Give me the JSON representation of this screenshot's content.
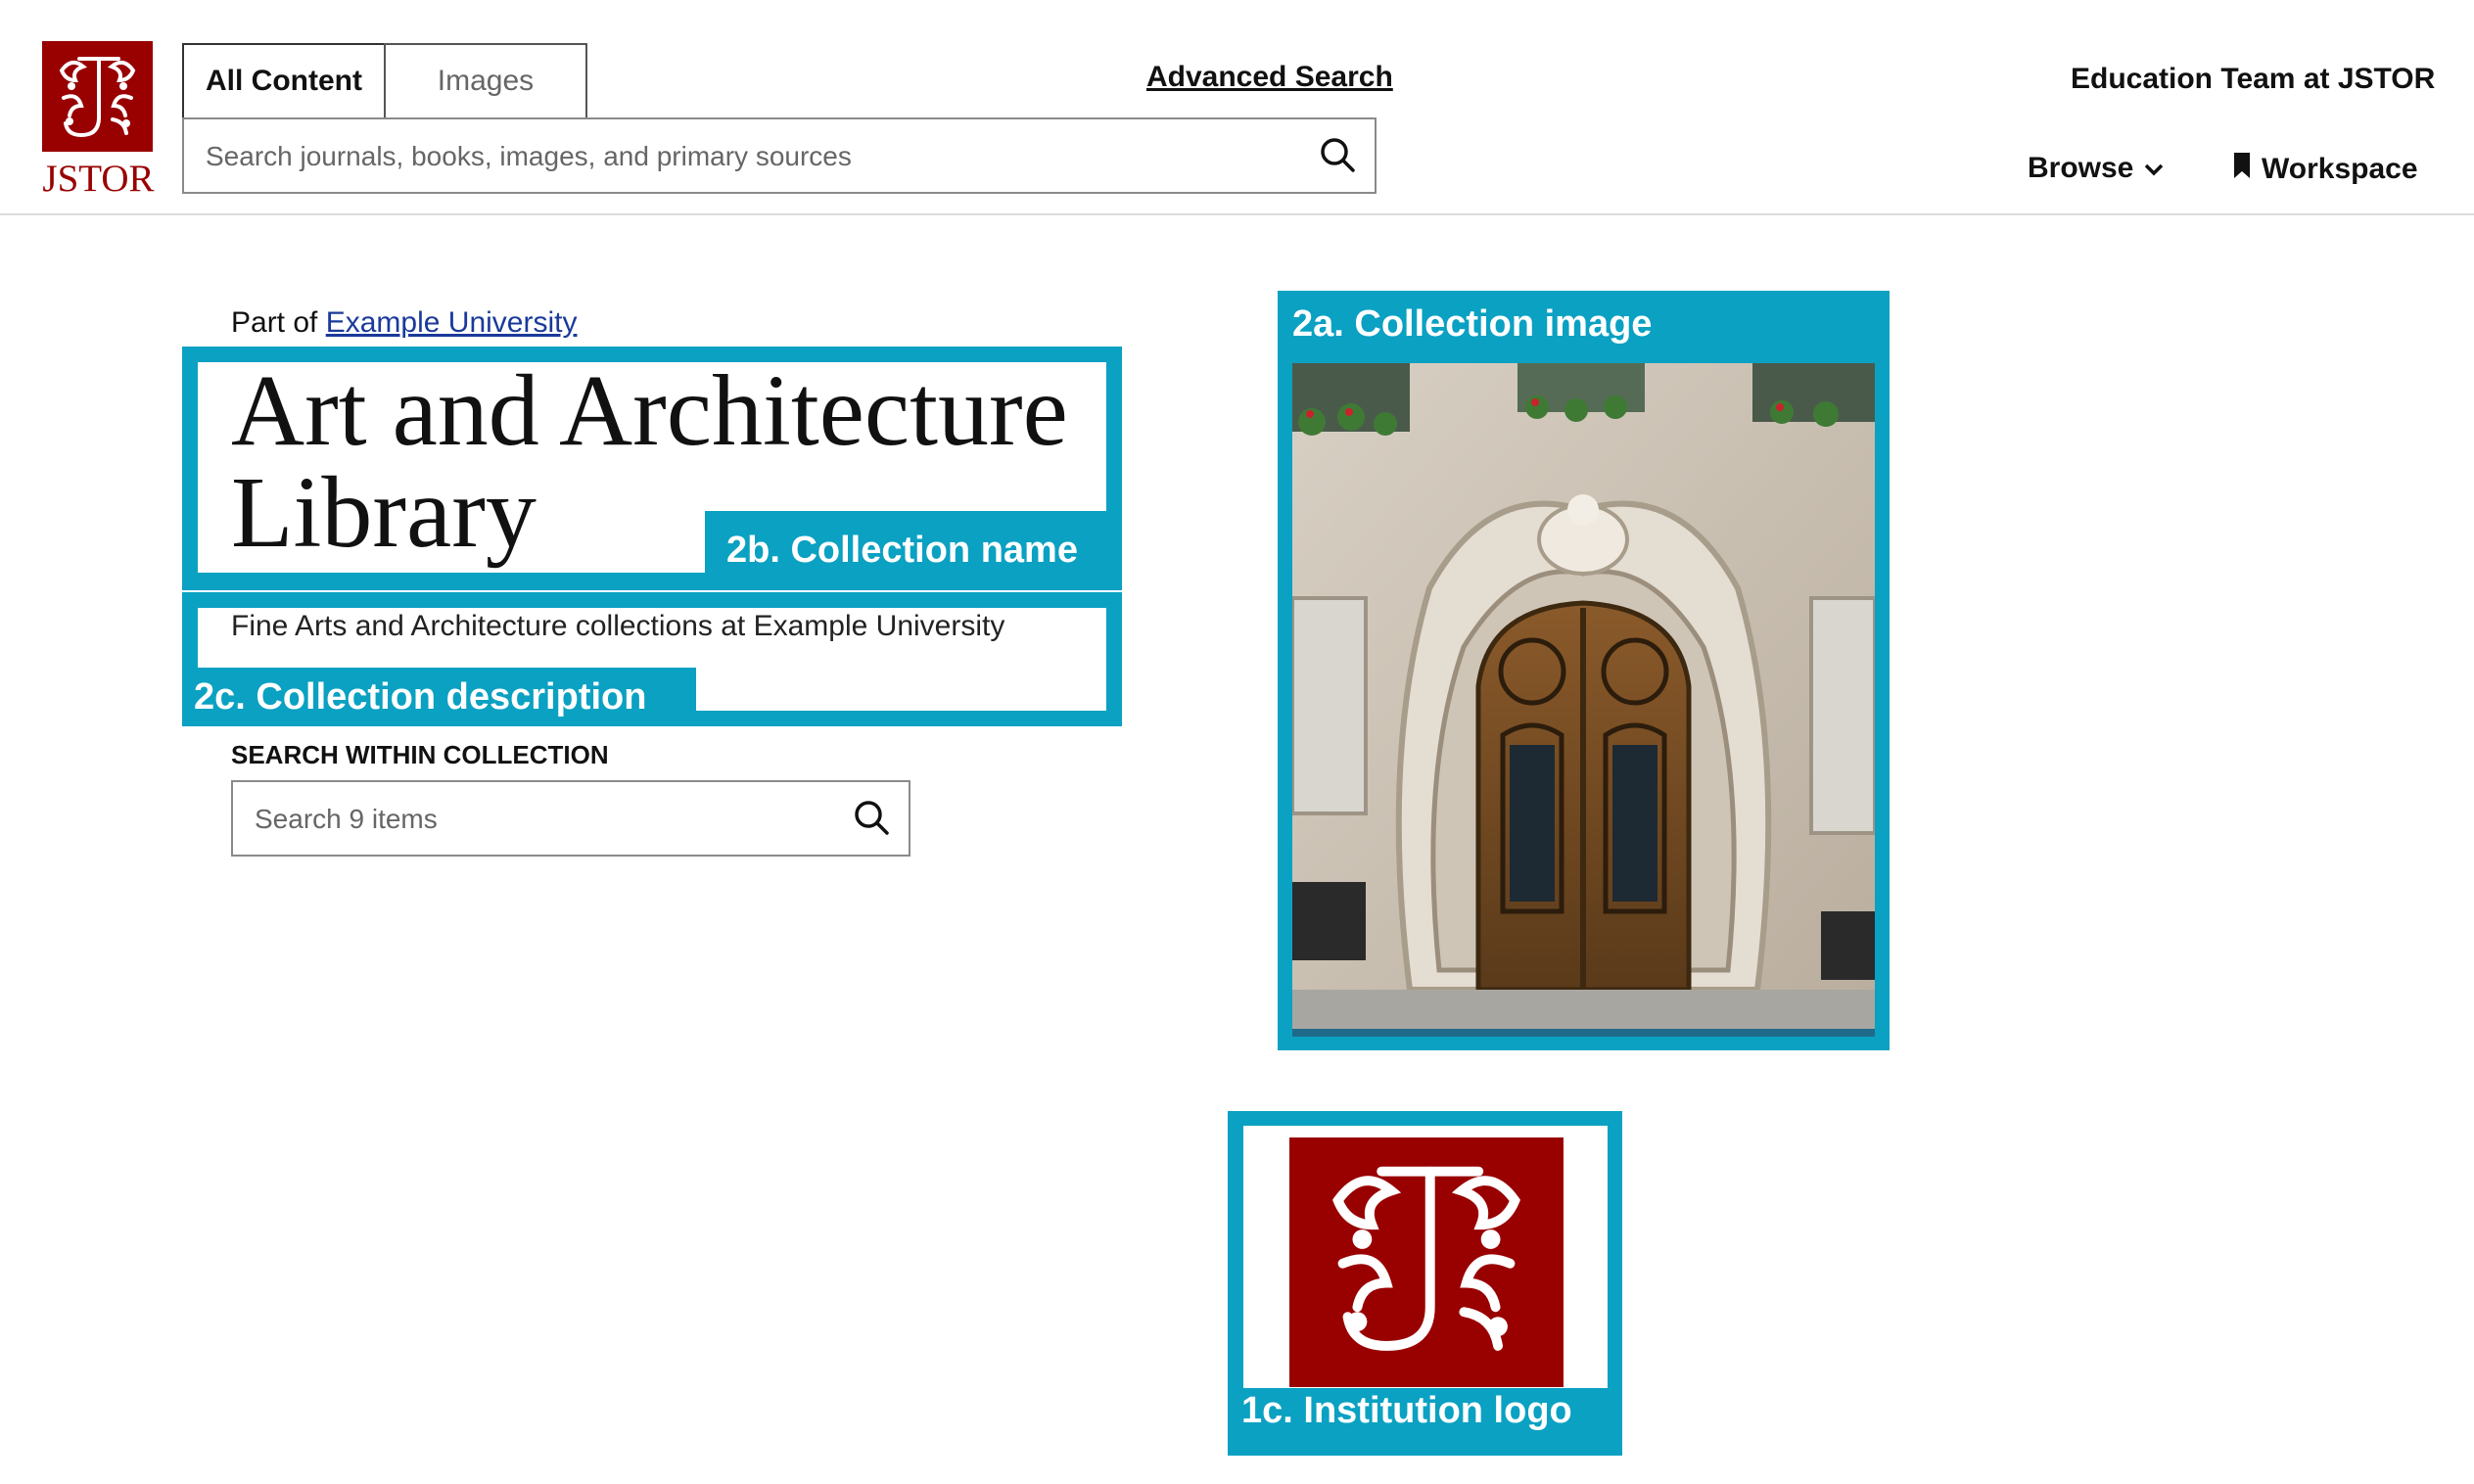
{
  "header": {
    "logo_text": "JSTOR",
    "tabs": [
      {
        "label": "All Content",
        "active": true
      },
      {
        "label": "Images",
        "active": false
      }
    ],
    "advanced_search": "Advanced Search",
    "search_placeholder": "Search journals, books, images, and primary sources",
    "user_name": "Education Team at JSTOR",
    "browse": "Browse",
    "workspace": "Workspace"
  },
  "collection": {
    "part_of_prefix": "Part of",
    "part_of_link": "Example University",
    "title_line1": "Art and Architecture",
    "title_line2": "Library",
    "description": "Fine Arts and Architecture collections at Example University",
    "search_within_label": "SEARCH WITHIN COLLECTION",
    "search_within_placeholder": "Search 9 items"
  },
  "annotations": {
    "collection_image": "2a. Collection image",
    "collection_name": "2b. Collection name",
    "collection_description": "2c. Collection description",
    "institution_logo": "1c. Institution logo"
  },
  "colors": {
    "annotation": "#0aa1c2",
    "brand": "#990000",
    "link": "#1a3a9a"
  }
}
